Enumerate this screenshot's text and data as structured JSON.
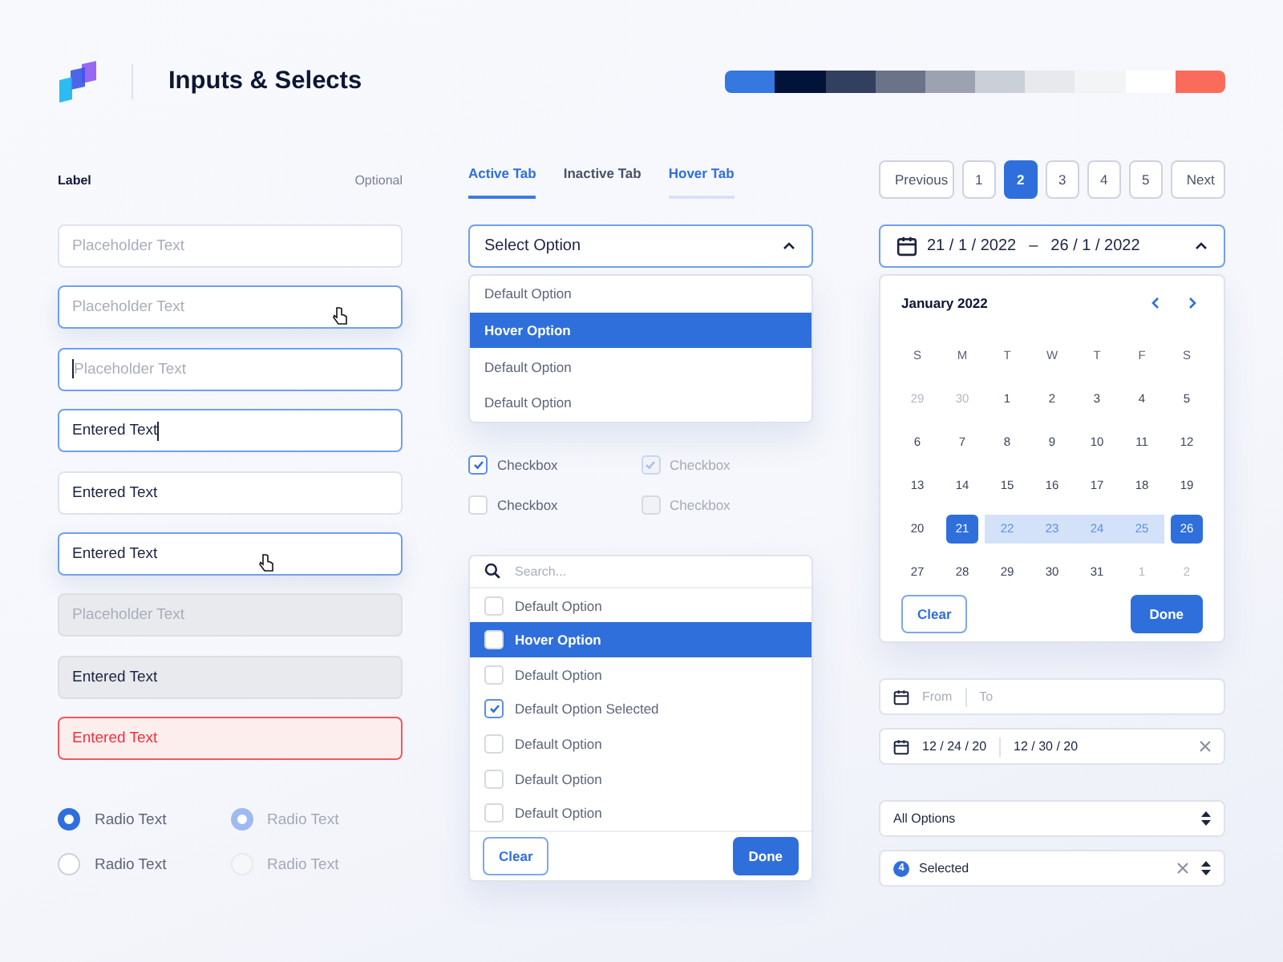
{
  "header": {
    "title": "Inputs & Selects"
  },
  "palette": [
    {
      "color": "#3478e0"
    },
    {
      "color": "#02133a"
    },
    {
      "color": "#323f5e"
    },
    {
      "color": "#6b7388"
    },
    {
      "color": "#9ca2b0"
    },
    {
      "color": "#cbcfd7"
    },
    {
      "color": "#e8e9ec"
    },
    {
      "color": "#f3f4f6"
    },
    {
      "color": "#ffffff"
    },
    {
      "color": "#fb6b5b"
    }
  ],
  "form_label": {
    "label": "Label",
    "hint": "Optional"
  },
  "inputs": [
    {
      "kind": "default",
      "placeholder": "Placeholder Text",
      "cursor": false,
      "caret": false
    },
    {
      "kind": "hover",
      "placeholder": "Placeholder Text",
      "cursor": true,
      "caret": false
    },
    {
      "kind": "focus",
      "placeholder": "Placeholder Text",
      "cursor": false,
      "caret": true
    },
    {
      "kind": "focus",
      "value": "Entered Text",
      "cursor": false,
      "caret": true
    },
    {
      "kind": "default",
      "value": "Entered Text",
      "cursor": false,
      "caret": false
    },
    {
      "kind": "hover",
      "value": "Entered Text",
      "cursor": true,
      "caret": false
    },
    {
      "kind": "disabled",
      "placeholder": "Placeholder Text",
      "cursor": false,
      "caret": false
    },
    {
      "kind": "disabled",
      "value": "Entered Text",
      "cursor": false,
      "caret": false
    },
    {
      "kind": "error",
      "value": "Entered Text",
      "cursor": false,
      "caret": false
    }
  ],
  "radios": [
    {
      "label": "Radio Text",
      "selected": true,
      "disabled": false
    },
    {
      "label": "Radio Text",
      "selected": true,
      "disabled": true
    },
    {
      "label": "Radio Text",
      "selected": false,
      "disabled": false
    },
    {
      "label": "Radio Text",
      "selected": false,
      "disabled": true
    }
  ],
  "tabs": [
    {
      "label": "Active Tab",
      "selected": true,
      "hovered": false
    },
    {
      "label": "Inactive Tab",
      "selected": false,
      "hovered": false
    },
    {
      "label": "Hover Tab",
      "selected": false,
      "hovered": true
    }
  ],
  "select": {
    "value": "Select Option",
    "expanded": true,
    "options": [
      {
        "label": "Default Option",
        "hovered": false
      },
      {
        "label": "Hover Option",
        "hovered": true
      },
      {
        "label": "Default Option",
        "hovered": false
      },
      {
        "label": "Default Option",
        "hovered": false
      }
    ]
  },
  "checkboxes": [
    {
      "label": "Checkbox",
      "checked": true,
      "disabled": false
    },
    {
      "label": "Checkbox",
      "checked": true,
      "disabled": true
    },
    {
      "label": "Checkbox",
      "checked": false,
      "disabled": false
    },
    {
      "label": "Checkbox",
      "checked": false,
      "disabled": true
    }
  ],
  "multiselect": {
    "search_placeholder": "Search...",
    "options": [
      {
        "label": "Default Option",
        "hovered": false,
        "checked": false
      },
      {
        "label": "Hover Option",
        "hovered": true,
        "checked": false
      },
      {
        "label": "Default Option",
        "hovered": false,
        "checked": false
      },
      {
        "label": "Default Option Selected",
        "hovered": false,
        "checked": true
      },
      {
        "label": "Default Option",
        "hovered": false,
        "checked": false
      },
      {
        "label": "Default Option",
        "hovered": false,
        "checked": false
      },
      {
        "label": "Default Option",
        "hovered": false,
        "checked": false
      }
    ],
    "clear": "Clear",
    "done": "Done"
  },
  "pagination": {
    "previous": "Previous",
    "pages": [
      {
        "label": "1",
        "selected": false
      },
      {
        "label": "2",
        "selected": true
      },
      {
        "label": "3",
        "selected": false
      },
      {
        "label": "4",
        "selected": false
      },
      {
        "label": "5",
        "selected": false
      }
    ],
    "next": "Next"
  },
  "date_range": {
    "start": "21 / 1 / 2022",
    "separator": "–",
    "end": "26 / 1 / 2022",
    "expanded": true
  },
  "calendar": {
    "month": "January 2022",
    "weekdays": [
      "S",
      "M",
      "T",
      "W",
      "T",
      "F",
      "S"
    ],
    "weeks": [
      [
        {
          "label": "29",
          "kind": "outside"
        },
        {
          "label": "30",
          "kind": "outside"
        },
        {
          "label": "1",
          "kind": "day"
        },
        {
          "label": "2",
          "kind": "day"
        },
        {
          "label": "3",
          "kind": "day"
        },
        {
          "label": "4",
          "kind": "day"
        },
        {
          "label": "5",
          "kind": "day"
        }
      ],
      [
        {
          "label": "6",
          "kind": "day"
        },
        {
          "label": "7",
          "kind": "day"
        },
        {
          "label": "8",
          "kind": "day"
        },
        {
          "label": "9",
          "kind": "day"
        },
        {
          "label": "10",
          "kind": "day"
        },
        {
          "label": "11",
          "kind": "day"
        },
        {
          "label": "12",
          "kind": "day"
        }
      ],
      [
        {
          "label": "13",
          "kind": "day"
        },
        {
          "label": "14",
          "kind": "day"
        },
        {
          "label": "15",
          "kind": "day"
        },
        {
          "label": "16",
          "kind": "day"
        },
        {
          "label": "17",
          "kind": "day"
        },
        {
          "label": "18",
          "kind": "day"
        },
        {
          "label": "19",
          "kind": "day"
        }
      ],
      [
        {
          "label": "20",
          "kind": "day"
        },
        {
          "label": "21",
          "kind": "start"
        },
        {
          "label": "22",
          "kind": "range"
        },
        {
          "label": "23",
          "kind": "range"
        },
        {
          "label": "24",
          "kind": "range"
        },
        {
          "label": "25",
          "kind": "range"
        },
        {
          "label": "26",
          "kind": "end"
        }
      ],
      [
        {
          "label": "27",
          "kind": "day"
        },
        {
          "label": "28",
          "kind": "day"
        },
        {
          "label": "29",
          "kind": "day"
        },
        {
          "label": "30",
          "kind": "day"
        },
        {
          "label": "31",
          "kind": "day"
        },
        {
          "label": "1",
          "kind": "outside"
        },
        {
          "label": "2",
          "kind": "outside"
        }
      ]
    ],
    "clear": "Clear",
    "done": "Done"
  },
  "range_fields": [
    {
      "from_placeholder": "From",
      "to_placeholder": "To",
      "clearable": false
    },
    {
      "from": "12 / 24 / 20",
      "to": "12 / 30 / 20",
      "clearable": true
    }
  ],
  "option_selects": [
    {
      "value": "All Options",
      "clearable": false
    },
    {
      "count": "4",
      "value": "Selected",
      "clearable": true
    }
  ]
}
